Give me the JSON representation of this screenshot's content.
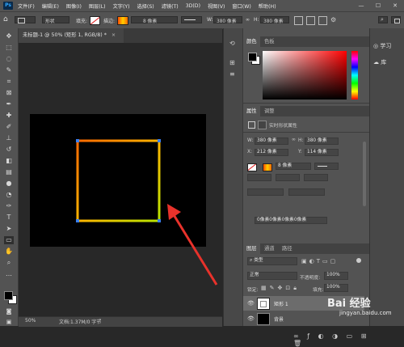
{
  "menu": {
    "logo": "Ps",
    "items": [
      "文件(F)",
      "编辑(E)",
      "图像(I)",
      "图层(L)",
      "文字(Y)",
      "选择(S)",
      "滤镜(T)",
      "3D(D)",
      "视图(V)",
      "窗口(W)",
      "帮助(H)"
    ],
    "minimize": "—",
    "maximize": "☐",
    "close": "✕"
  },
  "options": {
    "shape_mode": "形状",
    "fill_label": "填充:",
    "stroke_label": "描边:",
    "stroke_width": "8 像素",
    "w_label": "W:",
    "w_value": "380 像素",
    "link": "∞",
    "h_label": "H:",
    "h_value": "380 像素"
  },
  "document": {
    "tab_title": "未标题-1 @ 50% (矩形 1, RGB/8) *",
    "tab_close": "×",
    "zoom": "50%",
    "doc_info": "文档:1.37M/0 字节",
    "stroke_gradient": [
      "#ffb400",
      "#ff6a00",
      "#b7e400"
    ],
    "handle_color": "#3a7ff0"
  },
  "color_panel": {
    "tabs": [
      "颜色",
      "色板"
    ],
    "fg": "#000000",
    "bg": "#ffffff",
    "hue": "#ff0000"
  },
  "properties": {
    "tabs": [
      "属性",
      "调整"
    ],
    "title": "实时形状属性",
    "w_label": "W:",
    "w_value": "380 像素",
    "h_label": "H:",
    "h_value": "380 像素",
    "x_label": "X:",
    "x_value": "212 像素",
    "y_label": "Y:",
    "y_value": "114 像素",
    "stroke_width": "8 像素",
    "radius_value": "0像素0像素0像素0像素"
  },
  "layers": {
    "tabs": [
      "图层",
      "通道",
      "路径"
    ],
    "filter_label": "类型",
    "blend_mode": "正常",
    "opacity_label": "不透明度:",
    "opacity_value": "100%",
    "lock_label": "锁定:",
    "fill_label": "填充:",
    "fill_value": "100%",
    "items": [
      {
        "name": "矩形 1",
        "selected": true
      },
      {
        "name": "背景",
        "selected": false
      }
    ],
    "bottom_icons": [
      "link-icon",
      "fx-icon",
      "mask-icon",
      "adjustment-icon",
      "folder-icon",
      "new-layer-icon",
      "trash-icon"
    ]
  },
  "right_strip": {
    "learn": "学习",
    "library": "库"
  },
  "watermark": {
    "brand": "Bai 经验",
    "url": "jingyan.baidu.com"
  }
}
